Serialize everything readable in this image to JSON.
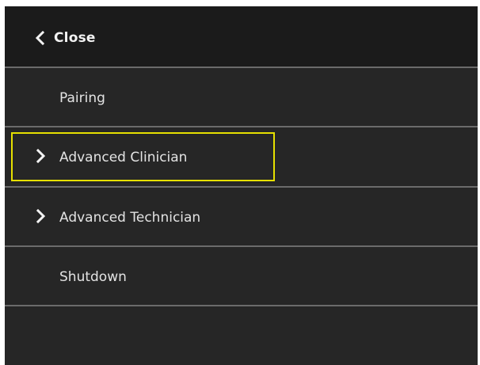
{
  "header": {
    "close_label": "Close",
    "close_icon": "chevron-left-icon"
  },
  "menu": {
    "items": [
      {
        "label": "Pairing",
        "has_submenu": false,
        "focused": false
      },
      {
        "label": "Advanced Clinician",
        "has_submenu": true,
        "focused": true,
        "icon": "chevron-right-icon"
      },
      {
        "label": "Advanced Technician",
        "has_submenu": true,
        "focused": false,
        "icon": "chevron-right-icon"
      },
      {
        "label": "Shutdown",
        "has_submenu": false,
        "focused": false
      }
    ]
  },
  "colors": {
    "panel_background": "#262626",
    "header_background": "#1b1b1b",
    "divider": "#6b6b6b",
    "text": "#e3e3e3",
    "focus_highlight": "#e6e000"
  }
}
